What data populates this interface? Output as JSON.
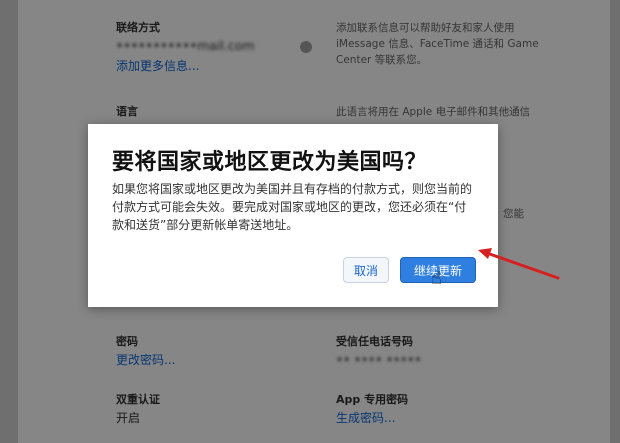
{
  "background": {
    "contact": {
      "label": "联络方式",
      "email": "•••••••••••mail.com",
      "add_more": "添加更多信息...",
      "desc_line1": "添加联系信息可以帮助好友和家人使用",
      "desc_line2": "iMessage 信息、FaceTime 通话和 Game",
      "desc_line3": "Center 等联系您。"
    },
    "language": {
      "label": "语言",
      "desc_line1": "此语言将用在 Apple 电子邮件和其他通信"
    },
    "side_fragment": "您能",
    "password": {
      "label": "密码",
      "link": "更改密码..."
    },
    "trusted_phone": {
      "label": "受信任电话号码",
      "value": "•• •••• •••••"
    },
    "two_factor": {
      "label": "双重认证",
      "value": "开启"
    },
    "app_password": {
      "label": "App 专用密码",
      "link": "生成密码..."
    }
  },
  "dialog": {
    "title": "要将国家或地区更改为美国吗？",
    "body": "如果您将国家或地区更改为美国并且有存档的付款方式，则您当前的付款方式可能会失效。要完成对国家或地区的更改，您还必须在“付款和送货”部分更新帐单寄送地址。",
    "cancel_label": "取消",
    "continue_label": "继续更新"
  },
  "colors": {
    "link": "#0b57b8",
    "primary_button": "#2f7fe0",
    "arrow": "#d62020"
  }
}
